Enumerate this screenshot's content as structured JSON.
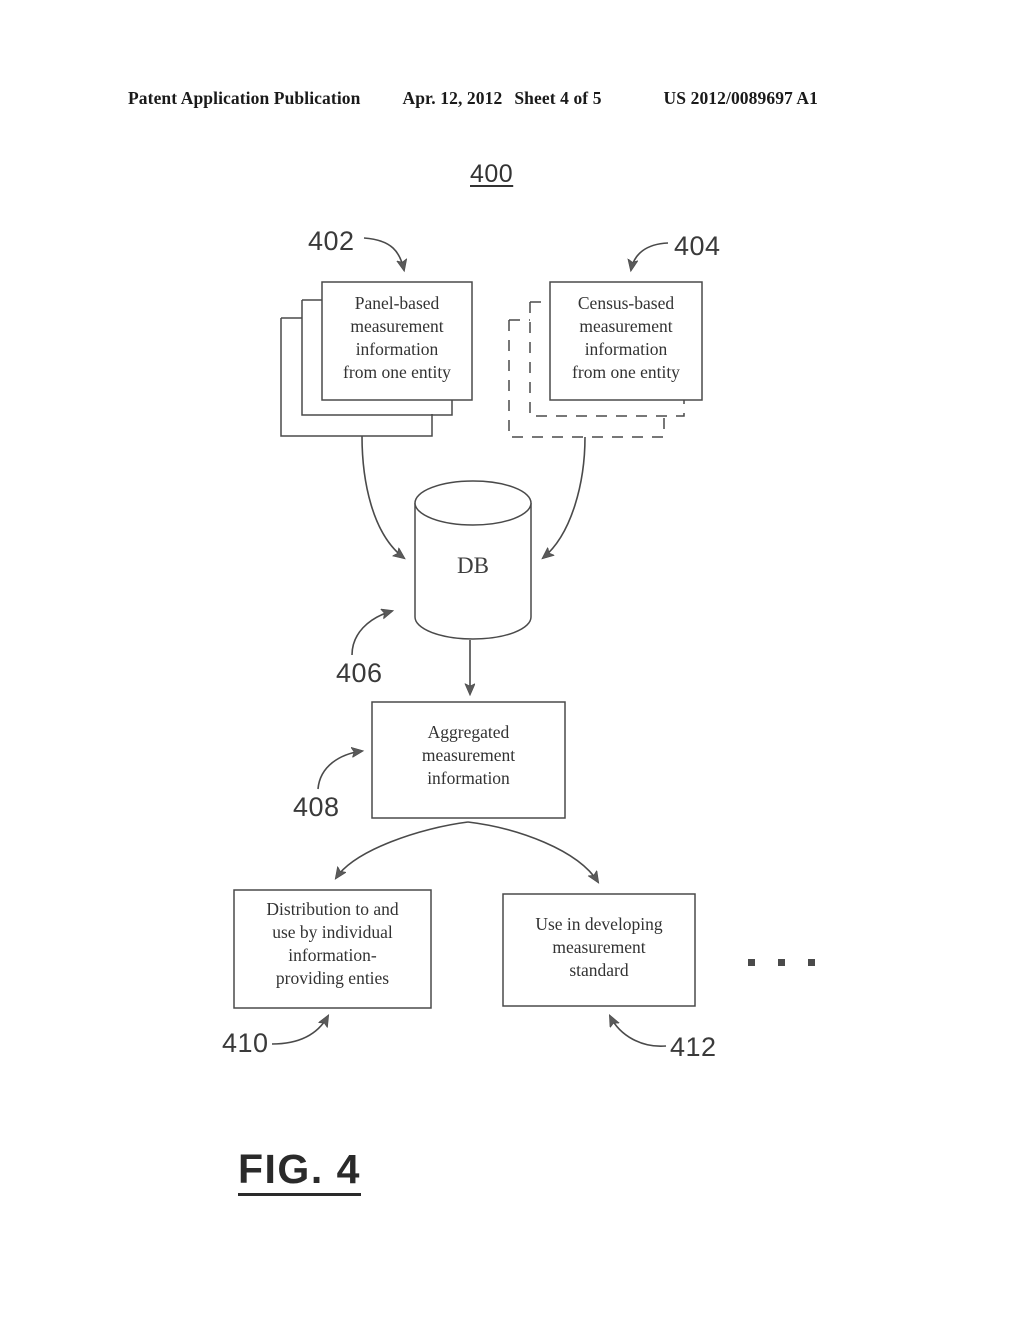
{
  "header": {
    "publication": "Patent Application Publication",
    "date": "Apr. 12, 2012",
    "sheet": "Sheet 4 of 5",
    "patent_number": "US 2012/0089697 A1"
  },
  "figure": {
    "figure_number": "400",
    "caption": "FIG. 4",
    "ellipsis": "· · ·"
  },
  "nodes": {
    "panel": {
      "ref": "402",
      "text": "Panel-based\nmeasurement\ninformation\nfrom one entity",
      "style": "stacked-solid"
    },
    "census": {
      "ref": "404",
      "text": "Census-based\nmeasurement\ninformation\nfrom one entity",
      "style": "stacked-dashed"
    },
    "database": {
      "ref": "406",
      "text": "DB",
      "style": "cylinder"
    },
    "aggregated": {
      "ref": "408",
      "text": "Aggregated\nmeasurement\ninformation",
      "style": "box"
    },
    "distribution": {
      "ref": "410",
      "text": "Distribution to and\nuse by individual\ninformation-\nproviding enties",
      "style": "box"
    },
    "standard": {
      "ref": "412",
      "text": "Use in developing\nmeasurement\nstandard",
      "style": "box"
    }
  },
  "colors": {
    "ink": "#3a3a3a",
    "line": "#4a4a4a",
    "paper": "#ffffff"
  }
}
